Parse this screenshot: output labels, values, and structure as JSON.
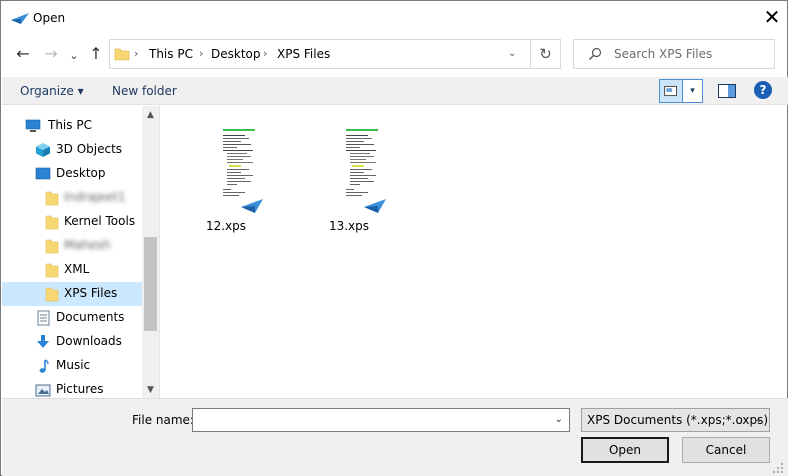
{
  "window": {
    "title": "Open",
    "close_glyph": "✕"
  },
  "nav": {
    "back_glyph": "←",
    "forward_glyph": "→",
    "up_glyph": "↑",
    "recent_glyph": "⌄",
    "refresh_glyph": "↻"
  },
  "address": {
    "segments": [
      "This PC",
      "Desktop",
      "XPS Files"
    ],
    "separator": "›",
    "dropdown_glyph": "⌄"
  },
  "search": {
    "placeholder": "Search XPS Files"
  },
  "toolbar": {
    "organize": "Organize ▾",
    "new_folder": "New folder",
    "views_drop_glyph": "▾",
    "help_glyph": "?"
  },
  "sidebar": {
    "items": [
      {
        "label": "This PC",
        "icon": "pc-icon"
      },
      {
        "label": "3D Objects",
        "icon": "cube-icon"
      },
      {
        "label": "Desktop",
        "icon": "desktop-icon"
      },
      {
        "label": "Indrajeet1",
        "icon": "folder-icon"
      },
      {
        "label": "Kernel Tools",
        "icon": "folder-icon"
      },
      {
        "label": "Mahesh",
        "icon": "folder-icon"
      },
      {
        "label": "XML",
        "icon": "folder-icon"
      },
      {
        "label": "XPS Files",
        "icon": "folder-icon"
      },
      {
        "label": "Documents",
        "icon": "documents-icon"
      },
      {
        "label": "Downloads",
        "icon": "download-icon"
      },
      {
        "label": "Music",
        "icon": "music-icon"
      },
      {
        "label": "Pictures",
        "icon": "pictures-icon"
      }
    ],
    "scroll_up_glyph": "▲",
    "scroll_down_glyph": "▼"
  },
  "files": [
    {
      "name": "12.xps"
    },
    {
      "name": "13.xps"
    }
  ],
  "bottom": {
    "file_name_label": "File name:",
    "file_name_value": "",
    "file_type": "XPS Documents (*.xps;*.oxps)",
    "dropdown_glyph": "⌄",
    "open_label": "Open",
    "cancel_label": "Cancel"
  },
  "colors": {
    "accent": "#0078d7",
    "selection": "#cce8ff",
    "folder": "#f8d775",
    "xps_icon": "#3b8fd9"
  }
}
